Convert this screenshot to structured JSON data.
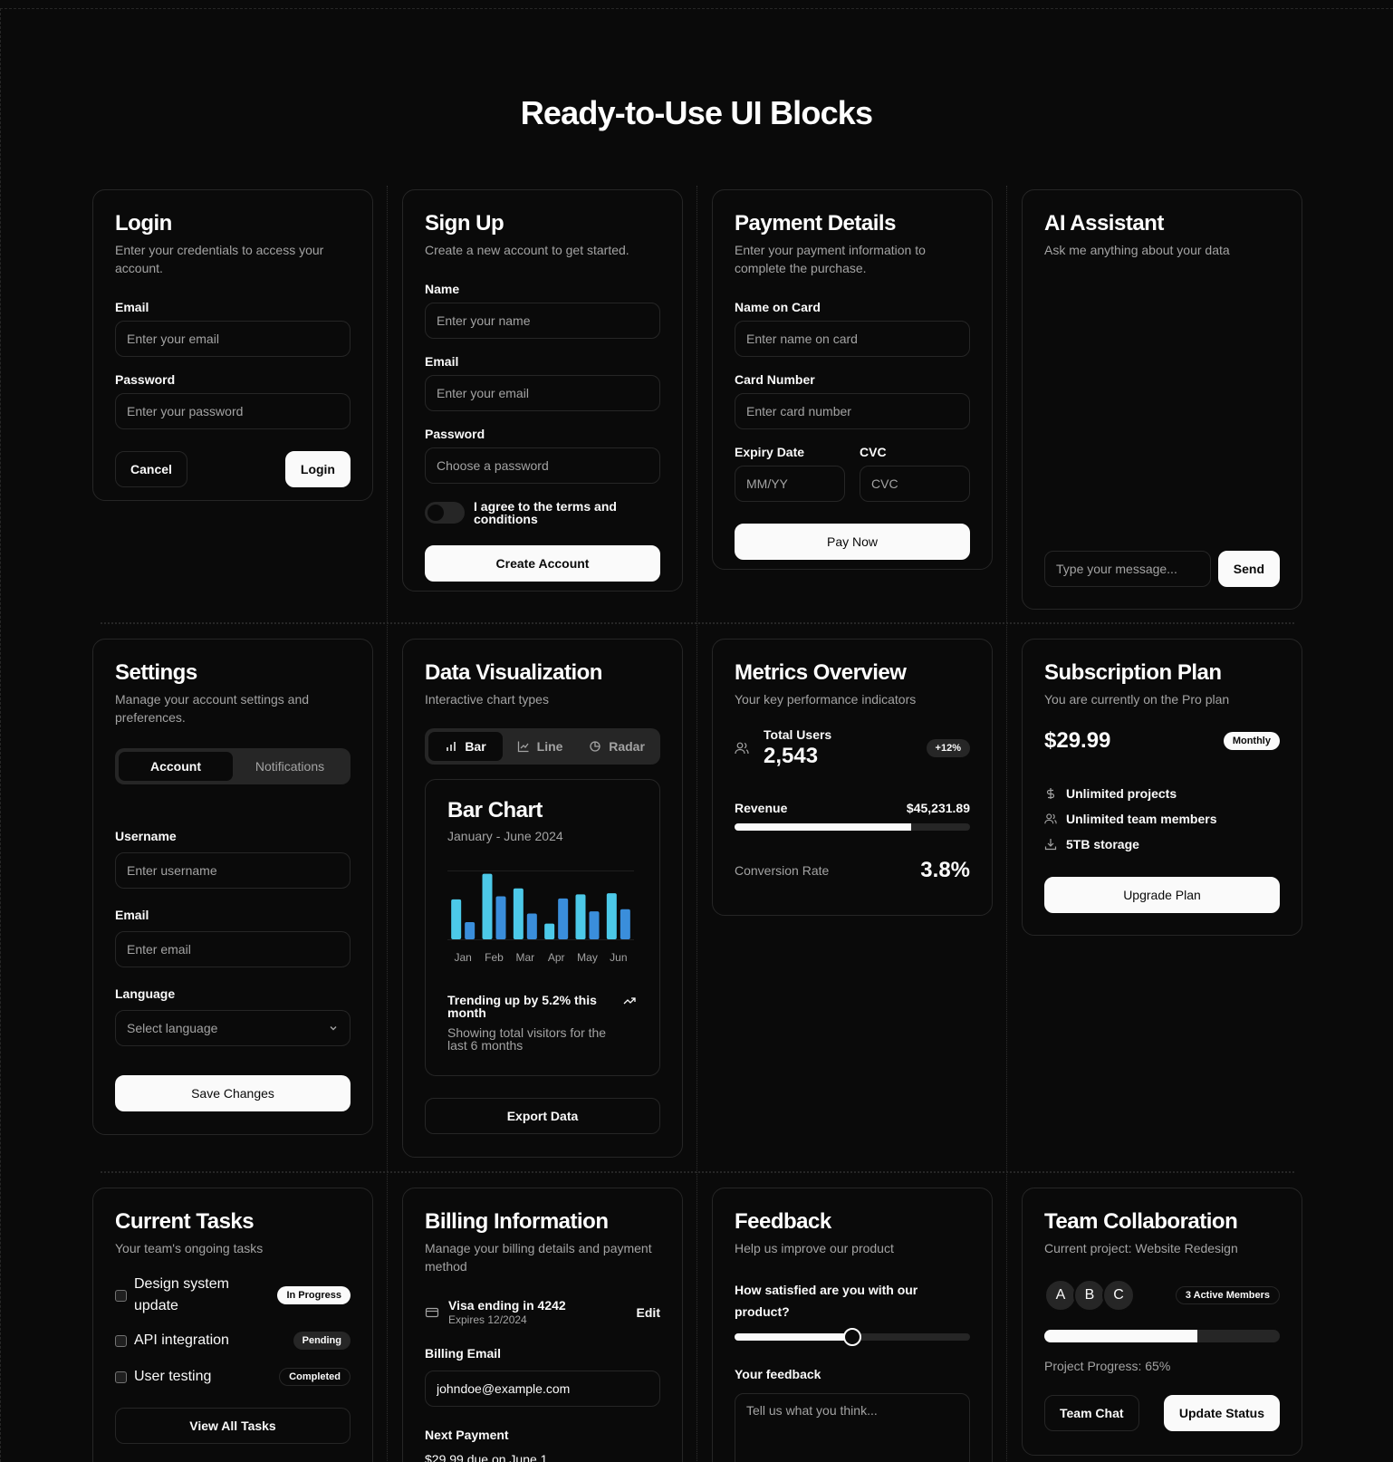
{
  "page": {
    "title": "Ready-to-Use UI Blocks"
  },
  "login": {
    "title": "Login",
    "subtitle": "Enter your credentials to access your account.",
    "email_label": "Email",
    "email_placeholder": "Enter your email",
    "password_label": "Password",
    "password_placeholder": "Enter your password",
    "cancel": "Cancel",
    "submit": "Login"
  },
  "signup": {
    "title": "Sign Up",
    "subtitle": "Create a new account to get started.",
    "name_label": "Name",
    "name_placeholder": "Enter your name",
    "email_label": "Email",
    "email_placeholder": "Enter your email",
    "password_label": "Password",
    "password_placeholder": "Choose a password",
    "terms": "I agree to the terms and conditions",
    "submit": "Create Account"
  },
  "payment": {
    "title": "Payment Details",
    "subtitle": "Enter your payment information to complete the purchase.",
    "name_label": "Name on Card",
    "name_placeholder": "Enter name on card",
    "number_label": "Card Number",
    "number_placeholder": "Enter card number",
    "expiry_label": "Expiry Date",
    "expiry_placeholder": "MM/YY",
    "cvc_label": "CVC",
    "cvc_placeholder": "CVC",
    "submit": "Pay Now"
  },
  "assistant": {
    "title": "AI Assistant",
    "subtitle": "Ask me anything about your data",
    "placeholder": "Type your message...",
    "send": "Send"
  },
  "settings": {
    "title": "Settings",
    "subtitle": "Manage your account settings and preferences.",
    "tabs": [
      "Account",
      "Notifications"
    ],
    "username_label": "Username",
    "username_placeholder": "Enter username",
    "email_label": "Email",
    "email_placeholder": "Enter email",
    "language_label": "Language",
    "language_value": "Select language",
    "submit": "Save Changes"
  },
  "dataviz": {
    "title": "Data Visualization",
    "subtitle": "Interactive chart types",
    "tabs": [
      "Bar",
      "Line",
      "Radar"
    ],
    "chart_title": "Bar Chart",
    "chart_subtitle": "January - June 2024",
    "trend": "Trending up by 5.2% this month",
    "footnote": "Showing total visitors for the last 6 months",
    "export": "Export Data",
    "colors": {
      "series1": "#4cc9e8",
      "series2": "#3a8edb"
    }
  },
  "chart_data": {
    "type": "bar",
    "categories": [
      "Jan",
      "Feb",
      "Mar",
      "Apr",
      "May",
      "Jun"
    ],
    "series": [
      {
        "values": [
          186,
          305,
          237,
          73,
          209,
          214
        ]
      },
      {
        "values": [
          80,
          200,
          120,
          190,
          130,
          140
        ]
      }
    ],
    "ylim": [
      0,
      320
    ],
    "grid": true,
    "title": "Bar Chart",
    "subtitle": "January - June 2024"
  },
  "metrics": {
    "title": "Metrics Overview",
    "subtitle": "Your key performance indicators",
    "users_label": "Total Users",
    "users_value": "2,543",
    "users_change": "+12%",
    "revenue_label": "Revenue",
    "revenue_value": "$45,231.89",
    "revenue_progress": 0.75,
    "conversion_label": "Conversion Rate",
    "conversion_value": "3.8%"
  },
  "subscription": {
    "title": "Subscription Plan",
    "subtitle": "You are currently on the Pro plan",
    "price": "$29.99",
    "period": "Monthly",
    "features": [
      {
        "icon": "dollar-icon",
        "text": "Unlimited projects"
      },
      {
        "icon": "users-icon",
        "text": "Unlimited team members"
      },
      {
        "icon": "download-icon",
        "text": "5TB storage"
      }
    ],
    "submit": "Upgrade Plan"
  },
  "tasks": {
    "title": "Current Tasks",
    "subtitle": "Your team's ongoing tasks",
    "items": [
      {
        "text": "Design system update",
        "status": "In Progress"
      },
      {
        "text": "API integration",
        "status": "Pending"
      },
      {
        "text": "User testing",
        "status": "Completed"
      }
    ],
    "view_all": "View All Tasks"
  },
  "billing": {
    "title": "Billing Information",
    "subtitle": "Manage your billing details and payment method",
    "card": "Visa ending in 4242",
    "expires": "Expires 12/2024",
    "edit": "Edit",
    "email_label": "Billing Email",
    "email_value": "johndoe@example.com",
    "next_label": "Next Payment",
    "next_value": "$29.99 due on June 1"
  },
  "feedback": {
    "title": "Feedback",
    "subtitle": "Help us improve our product",
    "question": "How satisfied are you with our product?",
    "satisfaction": 0.5,
    "feedback_label": "Your feedback",
    "feedback_placeholder": "Tell us what you think..."
  },
  "team": {
    "title": "Team Collaboration",
    "subtitle": "Current project: Website Redesign",
    "avatars": [
      "A",
      "B",
      "C"
    ],
    "members": "3 Active Members",
    "progress": 0.65,
    "progress_text": "Project Progress: 65%",
    "chat": "Team Chat",
    "update": "Update Status"
  }
}
